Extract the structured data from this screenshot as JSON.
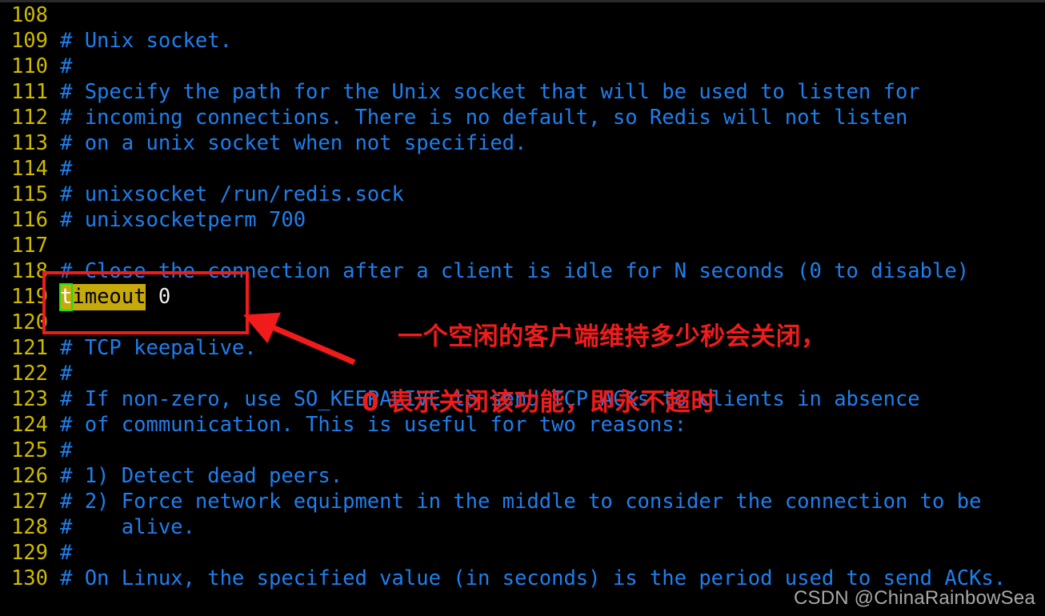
{
  "editor": {
    "background": "#000000",
    "lineno_color": "#cdba00",
    "comment_color": "#1e7fee",
    "text_color": "#f2f2f2",
    "highlight_bg": "#c8a90a",
    "cursor_outline": "#13e313",
    "lines": [
      {
        "no": "108",
        "text": ""
      },
      {
        "no": "109",
        "text": "# Unix socket."
      },
      {
        "no": "110",
        "text": "#"
      },
      {
        "no": "111",
        "text": "# Specify the path for the Unix socket that will be used to listen for"
      },
      {
        "no": "112",
        "text": "# incoming connections. There is no default, so Redis will not listen"
      },
      {
        "no": "113",
        "text": "# on a unix socket when not specified."
      },
      {
        "no": "114",
        "text": "#"
      },
      {
        "no": "115",
        "text": "# unixsocket /run/redis.sock"
      },
      {
        "no": "116",
        "text": "# unixsocketperm 700"
      },
      {
        "no": "117",
        "text": ""
      },
      {
        "no": "118",
        "text": "# Close the connection after a client is idle for N seconds (0 to disable)"
      },
      {
        "no": "119",
        "text": "timeout 0"
      },
      {
        "no": "120",
        "text": ""
      },
      {
        "no": "121",
        "text": "# TCP keepalive."
      },
      {
        "no": "122",
        "text": "#"
      },
      {
        "no": "123",
        "text": "# If non-zero, use SO_KEEPALIVE to send TCP ACKs to clients in absence"
      },
      {
        "no": "124",
        "text": "# of communication. This is useful for two reasons:"
      },
      {
        "no": "125",
        "text": "#"
      },
      {
        "no": "126",
        "text": "# 1) Detect dead peers."
      },
      {
        "no": "127",
        "text": "# 2) Force network equipment in the middle to consider the connection to be"
      },
      {
        "no": "128",
        "text": "#    alive."
      },
      {
        "no": "129",
        "text": "#"
      },
      {
        "no": "130",
        "text": "# On Linux, the specified value (in seconds) is the period used to send ACKs."
      }
    ],
    "active_line": {
      "no": "119",
      "cursor_char": "t",
      "highlighted_rest": "imeout",
      "value": "0"
    }
  },
  "annotation": {
    "color": "#f01c1c",
    "line1": "一个空闲的客户端维持多少秒会关闭，",
    "line2": "0 表示关闭该功能，即永不超时",
    "box_label": "timeout-highlight-box",
    "arrow_label": "red-arrow"
  },
  "watermark": {
    "text": "CSDN @ChinaRainbowSea"
  }
}
